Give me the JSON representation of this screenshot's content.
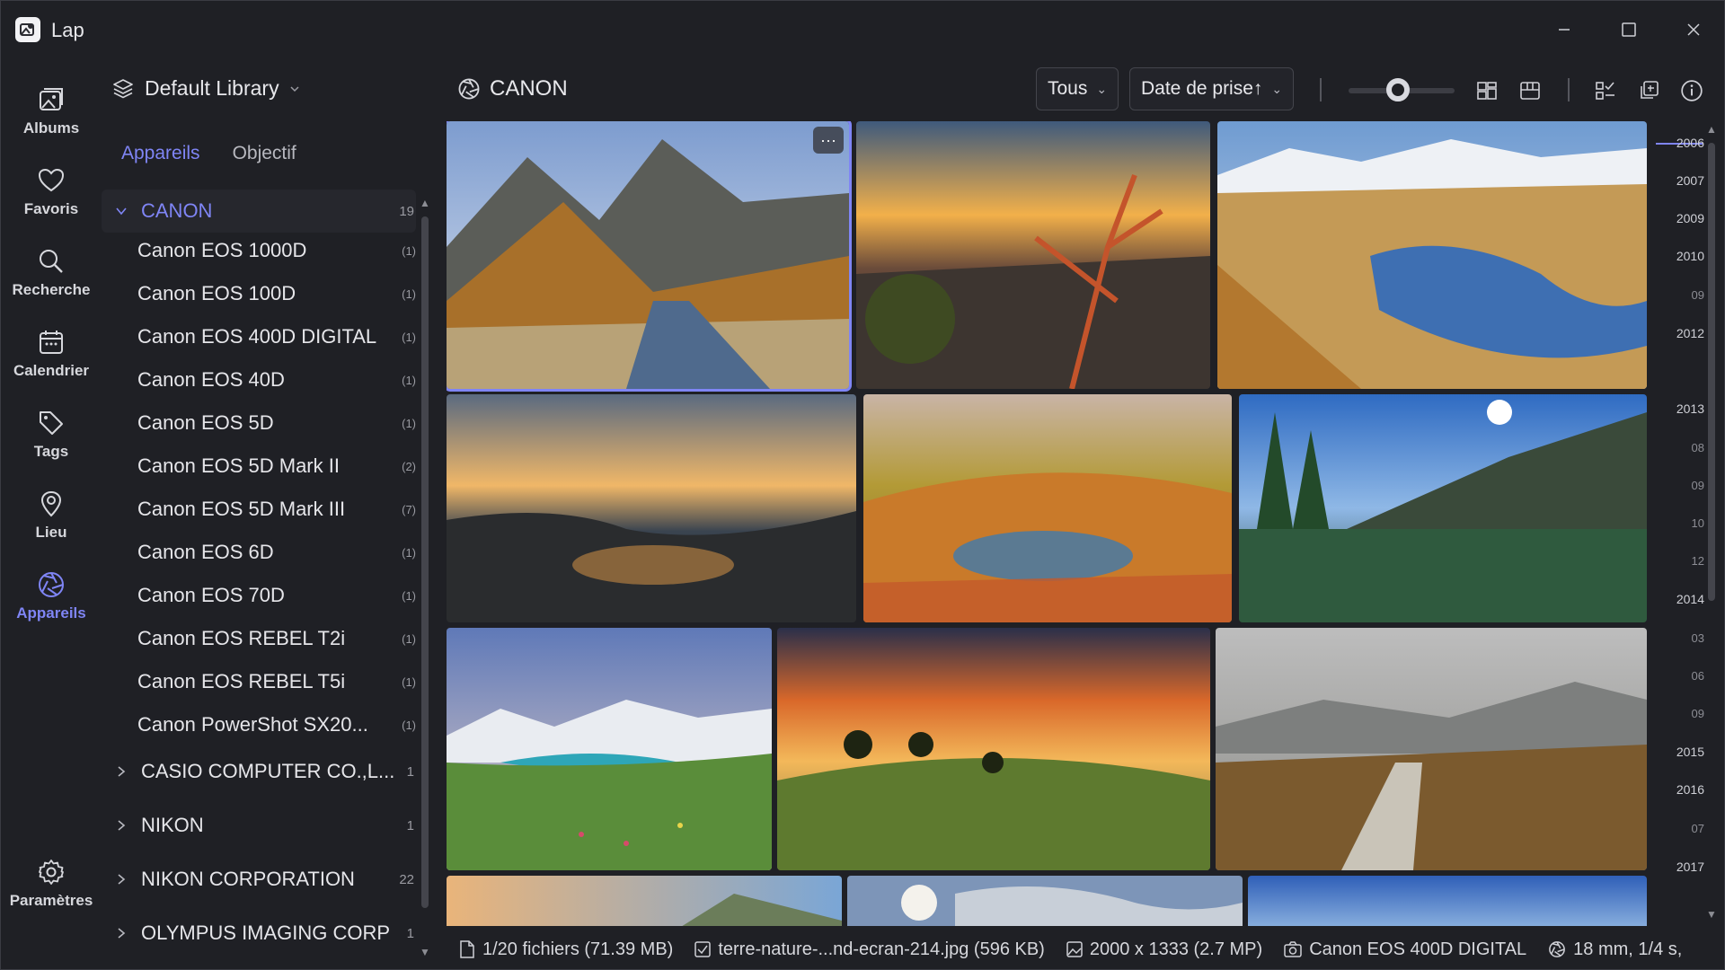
{
  "app": {
    "title": "Lap"
  },
  "rail": {
    "items": [
      {
        "label": "Albums",
        "icon": "albums-icon"
      },
      {
        "label": "Favoris",
        "icon": "heart-icon"
      },
      {
        "label": "Recherche",
        "icon": "search-icon"
      },
      {
        "label": "Calendrier",
        "icon": "calendar-icon"
      },
      {
        "label": "Tags",
        "icon": "tag-icon"
      },
      {
        "label": "Lieu",
        "icon": "location-pin-icon"
      },
      {
        "label": "Appareils",
        "icon": "aperture-icon",
        "active": true
      }
    ],
    "settings_label": "Paramètres"
  },
  "sidebar": {
    "library": "Default Library",
    "tabs": [
      {
        "label": "Appareils",
        "active": true
      },
      {
        "label": "Objectif"
      }
    ],
    "groups": [
      {
        "name": "CANON",
        "count": "19",
        "expanded": true,
        "children": [
          {
            "name": "Canon EOS 1000D",
            "count": "(1)"
          },
          {
            "name": "Canon EOS 100D",
            "count": "(1)"
          },
          {
            "name": "Canon EOS 400D DIGITAL",
            "count": "(1)"
          },
          {
            "name": "Canon EOS 40D",
            "count": "(1)"
          },
          {
            "name": "Canon EOS 5D",
            "count": "(1)"
          },
          {
            "name": "Canon EOS 5D Mark II",
            "count": "(2)"
          },
          {
            "name": "Canon EOS 5D Mark III",
            "count": "(7)"
          },
          {
            "name": "Canon EOS 6D",
            "count": "(1)"
          },
          {
            "name": "Canon EOS 70D",
            "count": "(1)"
          },
          {
            "name": "Canon EOS REBEL T2i",
            "count": "(1)"
          },
          {
            "name": "Canon EOS REBEL T5i",
            "count": "(1)"
          },
          {
            "name": "Canon PowerShot SX20...",
            "count": "(1)"
          }
        ]
      },
      {
        "name": "CASIO COMPUTER CO.,L...",
        "count": "1"
      },
      {
        "name": "NIKON",
        "count": "1"
      },
      {
        "name": "NIKON CORPORATION",
        "count": "22"
      },
      {
        "name": "OLYMPUS IMAGING CORP",
        "count": "1"
      }
    ]
  },
  "header": {
    "title": "CANON",
    "filter": "Tous",
    "sort": "Date de prise↑"
  },
  "timeline": [
    {
      "label": "2006",
      "major": true
    },
    {
      "label": "2007",
      "major": true
    },
    {
      "label": "2009",
      "major": true
    },
    {
      "label": "2010",
      "major": true
    },
    {
      "label": "09",
      "major": false
    },
    {
      "label": "2012",
      "major": true
    },
    {
      "label": "2013",
      "major": true
    },
    {
      "label": "08",
      "major": false
    },
    {
      "label": "09",
      "major": false
    },
    {
      "label": "10",
      "major": false
    },
    {
      "label": "12",
      "major": false
    },
    {
      "label": "2014",
      "major": true
    },
    {
      "label": "03",
      "major": false
    },
    {
      "label": "06",
      "major": false
    },
    {
      "label": "09",
      "major": false
    },
    {
      "label": "2015",
      "major": true
    },
    {
      "label": "2016",
      "major": true
    },
    {
      "label": "07",
      "major": false
    },
    {
      "label": "2017",
      "major": true
    }
  ],
  "status": {
    "files": "1/20 fichiers (71.39 MB)",
    "filename": "terre-nature-...nd-ecran-214.jpg (596 KB)",
    "dimensions": "2000 x 1333 (2.7 MP)",
    "camera": "Canon EOS 400D DIGITAL",
    "exposure": "18 mm, 1/4 s,"
  },
  "colors": {
    "accent": "#7f85f5",
    "background": "#1f2025"
  }
}
